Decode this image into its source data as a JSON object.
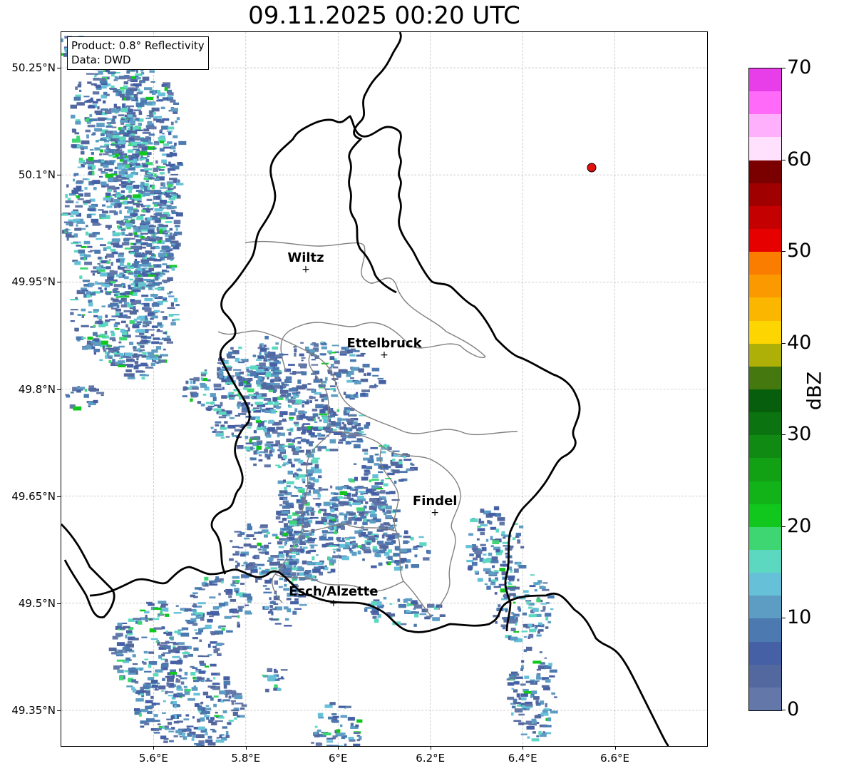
{
  "title": "09.11.2025 00:20 UTC",
  "info_box": {
    "product": "Product: 0.8° Reflectivity",
    "source": "Data: DWD"
  },
  "axes": {
    "lat_ticks": [
      "50.25°N",
      "50.1°N",
      "49.95°N",
      "49.8°N",
      "49.65°N",
      "49.5°N",
      "49.35°N"
    ],
    "lon_ticks": [
      "5.6°E",
      "5.8°E",
      "6°E",
      "6.2°E",
      "6.4°E",
      "6.6°E"
    ],
    "lat_values": [
      50.25,
      50.1,
      49.95,
      49.8,
      49.65,
      49.5,
      49.35
    ],
    "lon_values": [
      5.6,
      5.8,
      6.0,
      6.2,
      6.4,
      6.6
    ],
    "lon_range": [
      5.4,
      6.8
    ],
    "lat_range": [
      49.3,
      50.3
    ],
    "grid": true
  },
  "cities": [
    {
      "name": "Wiltz",
      "lon": 5.93,
      "lat": 49.967
    },
    {
      "name": "Ettelbruck",
      "lon": 6.1,
      "lat": 49.847
    },
    {
      "name": "Findel",
      "lon": 6.21,
      "lat": 49.627
    },
    {
      "name": "Esch/Alzette",
      "lon": 5.99,
      "lat": 49.5
    }
  ],
  "point_marker": {
    "lon": 6.55,
    "lat": 50.11,
    "color": "#e31010"
  },
  "colorbar": {
    "label": "dBZ",
    "min": 0,
    "max": 70,
    "step": 2.5,
    "tick_labels": [
      "0",
      "10",
      "20",
      "30",
      "40",
      "50",
      "60",
      "70"
    ],
    "tick_values": [
      0,
      10,
      20,
      30,
      40,
      50,
      60,
      70
    ],
    "colors": [
      "#6378a8",
      "#53689f",
      "#4660a5",
      "#4b79b0",
      "#5d9dc4",
      "#66c1d8",
      "#5cd7c0",
      "#3ed672",
      "#11c71d",
      "#12b319",
      "#12a015",
      "#108a12",
      "#0b7410",
      "#075f0e",
      "#45780e",
      "#aeb008",
      "#fdd500",
      "#fbb600",
      "#fb9a00",
      "#fb7d00",
      "#e60000",
      "#c40000",
      "#a10000",
      "#7a0000",
      "#ffe1fe",
      "#ffb0fd",
      "#ff6af9",
      "#e83ee9"
    ]
  },
  "colors": {
    "border_country": "#000000",
    "border_canton": "#808080",
    "grid": "#b0b0b0"
  }
}
